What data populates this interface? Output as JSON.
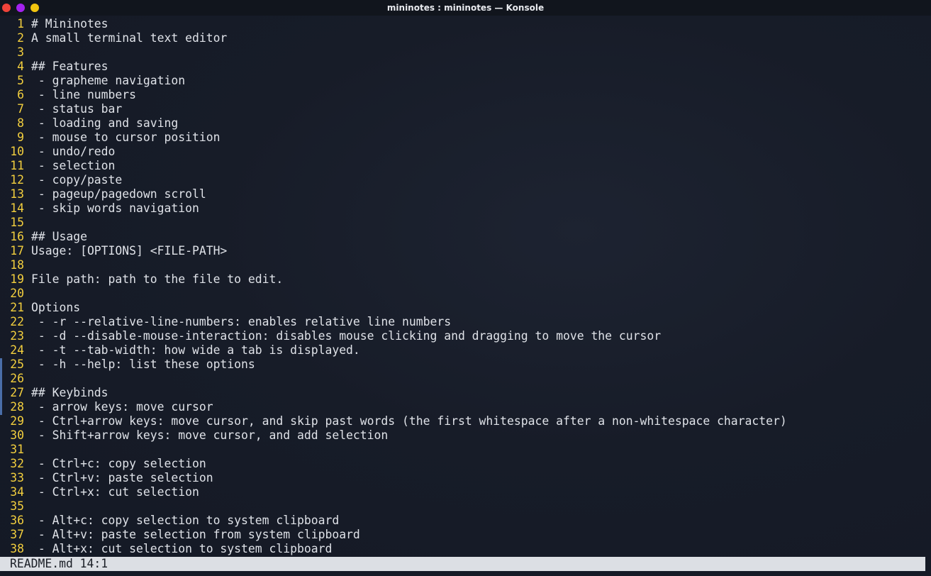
{
  "window": {
    "title": "mininotes : mininotes — Konsole",
    "buttons": [
      {
        "name": "close",
        "color": "#f0433a"
      },
      {
        "name": "minimize",
        "color": "#a422f0"
      },
      {
        "name": "maximize",
        "color": "#f1c40f"
      }
    ]
  },
  "editor": {
    "lines": [
      {
        "num": "1",
        "text": "# Mininotes"
      },
      {
        "num": "2",
        "text": "A small terminal text editor"
      },
      {
        "num": "3",
        "text": ""
      },
      {
        "num": "4",
        "text": "## Features"
      },
      {
        "num": "5",
        "text": " - grapheme navigation"
      },
      {
        "num": "6",
        "text": " - line numbers"
      },
      {
        "num": "7",
        "text": " - status bar"
      },
      {
        "num": "8",
        "text": " - loading and saving"
      },
      {
        "num": "9",
        "text": " - mouse to cursor position"
      },
      {
        "num": "10",
        "text": " - undo/redo"
      },
      {
        "num": "11",
        "text": " - selection"
      },
      {
        "num": "12",
        "text": " - copy/paste"
      },
      {
        "num": "13",
        "text": " - pageup/pagedown scroll"
      },
      {
        "num": "14",
        "text": " - skip words navigation"
      },
      {
        "num": "15",
        "text": ""
      },
      {
        "num": "16",
        "text": "## Usage"
      },
      {
        "num": "17",
        "text": "Usage: [OPTIONS] <FILE-PATH>"
      },
      {
        "num": "18",
        "text": ""
      },
      {
        "num": "19",
        "text": "File path: path to the file to edit."
      },
      {
        "num": "20",
        "text": ""
      },
      {
        "num": "21",
        "text": "Options"
      },
      {
        "num": "22",
        "text": " - -r --relative-line-numbers: enables relative line numbers"
      },
      {
        "num": "23",
        "text": " - -d --disable-mouse-interaction: disables mouse clicking and dragging to move the cursor"
      },
      {
        "num": "24",
        "text": " - -t --tab-width: how wide a tab is displayed."
      },
      {
        "num": "25",
        "text": " - -h --help: list these options"
      },
      {
        "num": "26",
        "text": ""
      },
      {
        "num": "27",
        "text": "## Keybinds"
      },
      {
        "num": "28",
        "text": " - arrow keys: move cursor"
      },
      {
        "num": "29",
        "text": " - Ctrl+arrow keys: move cursor, and skip past words (the first whitespace after a non-whitespace character)"
      },
      {
        "num": "30",
        "text": " - Shift+arrow keys: move cursor, and add selection"
      },
      {
        "num": "31",
        "text": ""
      },
      {
        "num": "32",
        "text": " - Ctrl+c: copy selection"
      },
      {
        "num": "33",
        "text": " - Ctrl+v: paste selection"
      },
      {
        "num": "34",
        "text": " - Ctrl+x: cut selection"
      },
      {
        "num": "35",
        "text": ""
      },
      {
        "num": "36",
        "text": " - Alt+c: copy selection to system clipboard"
      },
      {
        "num": "37",
        "text": " - Alt+v: paste selection from system clipboard"
      },
      {
        "num": "38",
        "text": " - Alt+x: cut selection to system clipboard"
      }
    ]
  },
  "status": {
    "text": "README.md 14:1"
  }
}
